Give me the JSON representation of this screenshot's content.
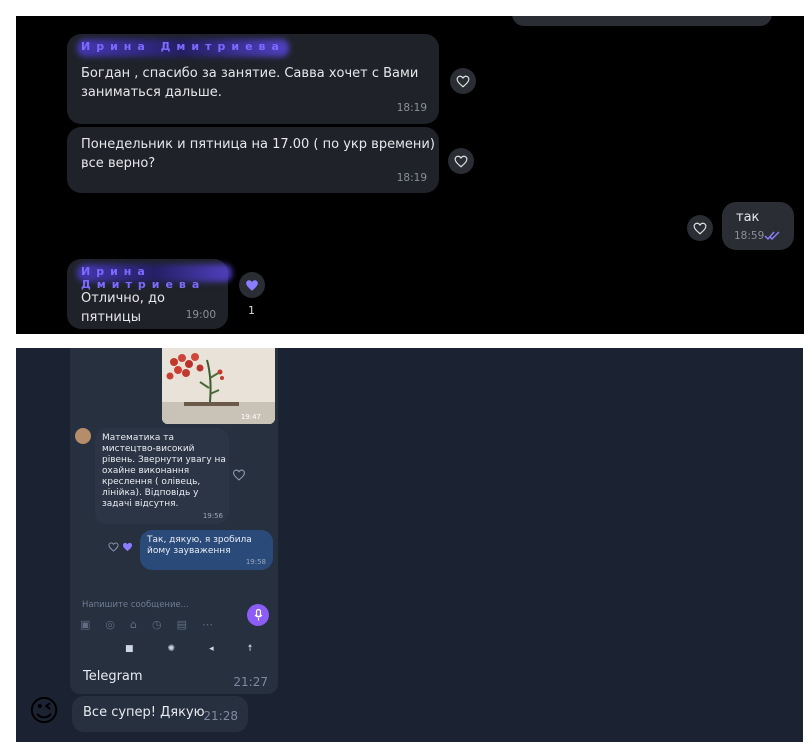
{
  "top": {
    "messages": [
      {
        "sender": "Ирина Дмитриева",
        "emoji": "😍",
        "text_line1": "Богдан , спасибо за занятие. Савва хочет с Вами",
        "text_line2": "заниматься дальше.",
        "time": "18:19"
      },
      {
        "text_line1": "Понедельник и пятница на 17.00 ( по укр времени) ,",
        "text_line2": "все верно?",
        "time": "18:19"
      },
      {
        "outgoing": true,
        "text": "так",
        "time": "18:59"
      },
      {
        "sender": "Ирина Дмитриева",
        "emoji": "😍",
        "text": "Отлично, до пятницы",
        "time": "19:00",
        "like_count": "1"
      }
    ],
    "colors": {
      "bubble": "#1f2229",
      "accent": "#7b6cff",
      "bg": "#000000"
    }
  },
  "bottom": {
    "photo_time": "19:47",
    "incoming": {
      "lines": [
        "Математика та",
        "мистецтво-високий",
        "рівень. Звернути увагу на",
        "охайне виконання",
        "креслення ( олівець,",
        "лінійка). Відповідь у",
        "задачі відсутня."
      ],
      "time": "19:56"
    },
    "outgoing": {
      "lines": [
        "Так, дякую, я зробила",
        "йому зауваження"
      ],
      "time": "19:58"
    },
    "input_placeholder": "Напишите сообщение...",
    "telegram": {
      "label": "Telegram",
      "time": "21:27"
    },
    "final": {
      "emoji": "😉",
      "text": "Все супер! Дякую",
      "time": "21:28"
    },
    "colors": {
      "bg": "#1b2231",
      "bubble_in": "#2c3545",
      "bubble_out": "#2a4a7a",
      "mic": "#8b5cf6"
    }
  }
}
